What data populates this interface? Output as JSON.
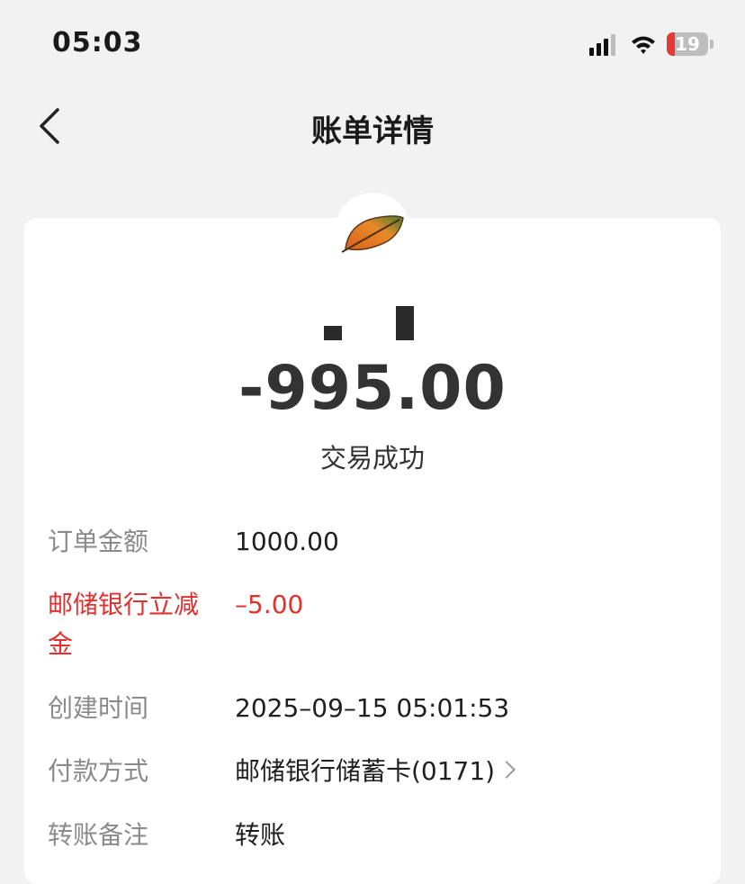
{
  "status_bar": {
    "time": "05:03",
    "battery": "19",
    "battery_level": 0.19
  },
  "nav": {
    "title": "账单详情"
  },
  "detail": {
    "amount": "-995.00",
    "status": "交易成功",
    "rows": [
      {
        "label": "订单金额",
        "value": "1000.00"
      },
      {
        "label": "邮储银行立减金",
        "value": "–5.00"
      },
      {
        "label": "创建时间",
        "value": "2025–09–15 05:01:53"
      },
      {
        "label": "付款方式",
        "value": "邮储银行储蓄卡(0171)"
      },
      {
        "label": "转账备注",
        "value": "转账"
      }
    ]
  },
  "icons": {
    "back": "chevron-left-icon",
    "logo": "leaf-icon",
    "payment_chevron": "chevron-right-icon"
  },
  "colors": {
    "background": "#f2f2f2",
    "card": "#ffffff",
    "accent_red": "#e1302e",
    "label_gray": "#8a8a8a",
    "battery_low": "#e53935"
  }
}
